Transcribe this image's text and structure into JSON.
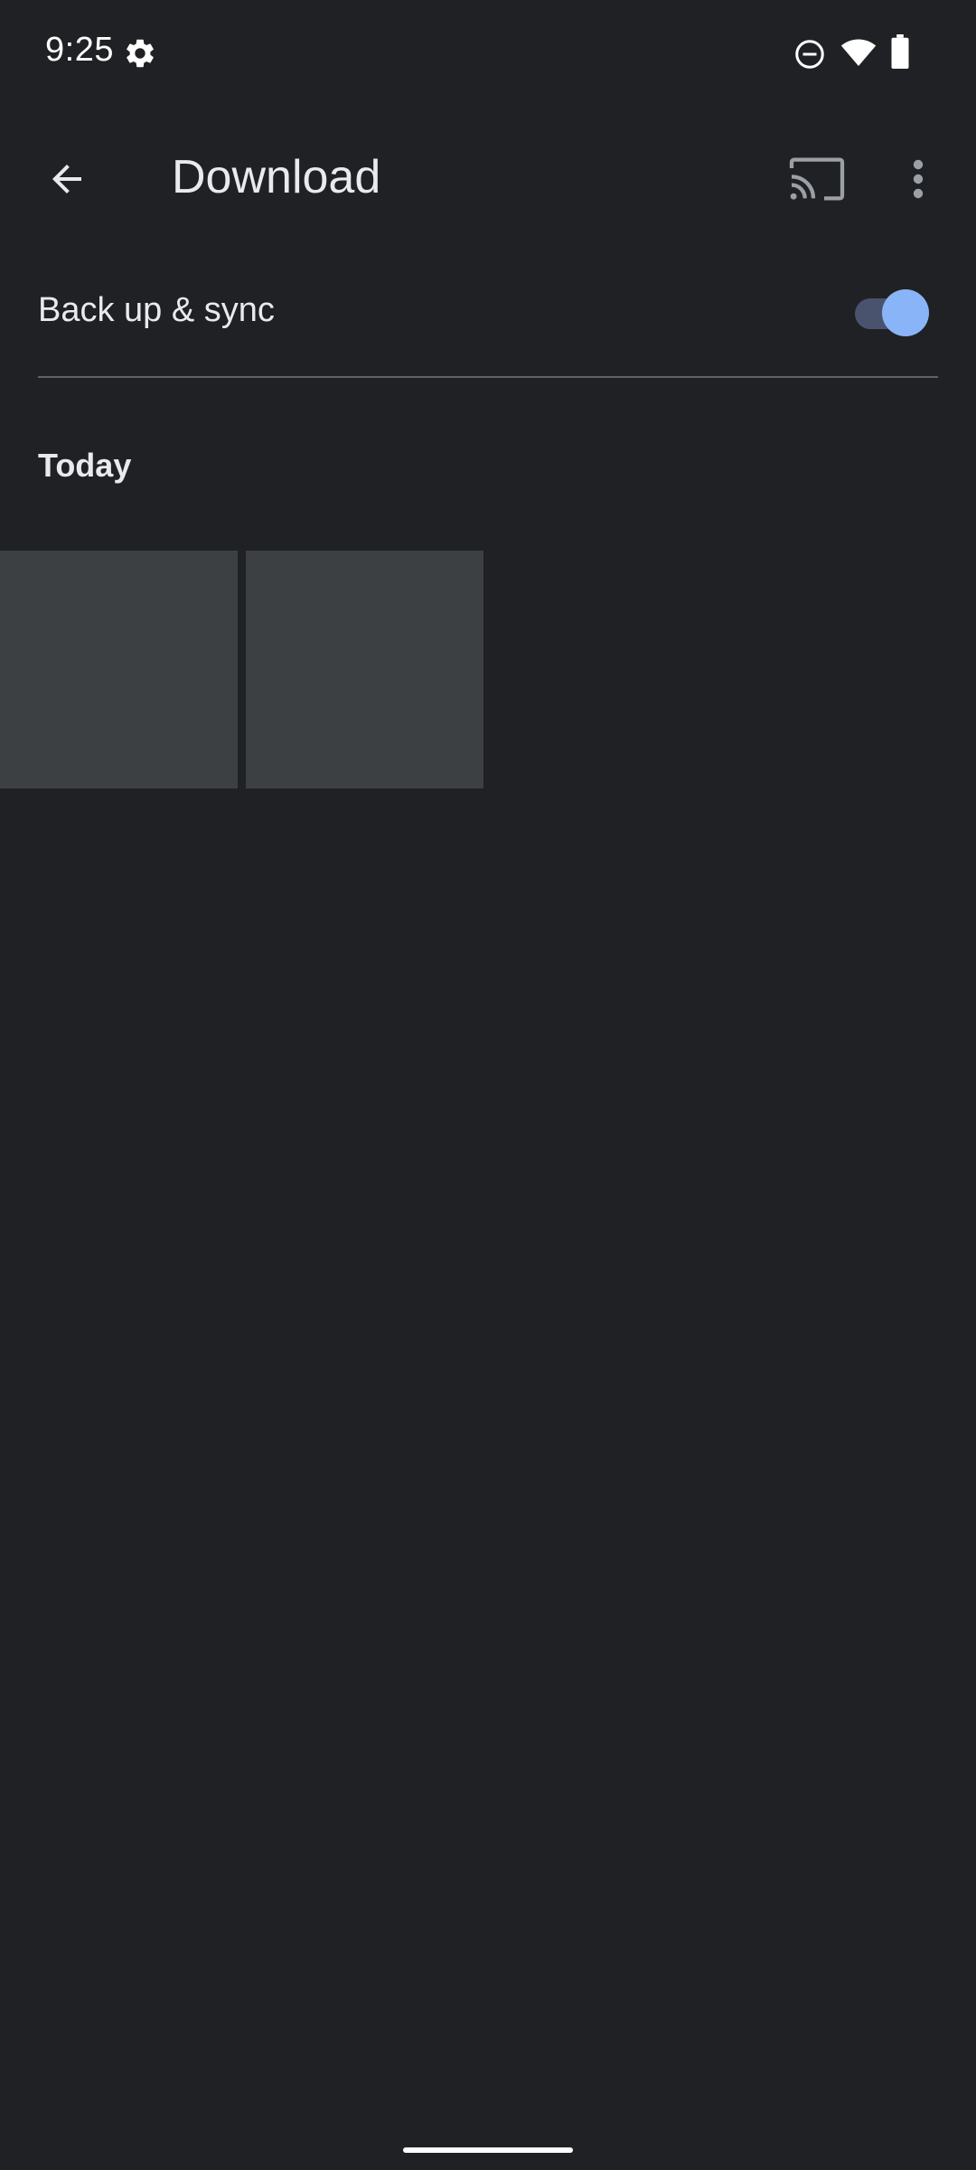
{
  "status_bar": {
    "time": "9:25",
    "icons": [
      "gear-icon",
      "do-not-disturb-icon",
      "wifi-icon",
      "battery-icon"
    ]
  },
  "app_bar": {
    "title": "Download",
    "back_icon": "arrow-back-icon",
    "cast_icon": "cast-icon",
    "more_icon": "more-vert-icon"
  },
  "sync": {
    "label": "Back up & sync",
    "enabled": true
  },
  "section": {
    "header": "Today"
  },
  "thumbnails": [
    {
      "type": "image-placeholder"
    },
    {
      "type": "image-placeholder"
    }
  ],
  "colors": {
    "background": "#202124",
    "thumbnail": "#3c4043",
    "toggle_thumb": "#8ab4f8",
    "toggle_track": "#49536e",
    "divider": "#5f6368",
    "text": "#e8eaed"
  }
}
